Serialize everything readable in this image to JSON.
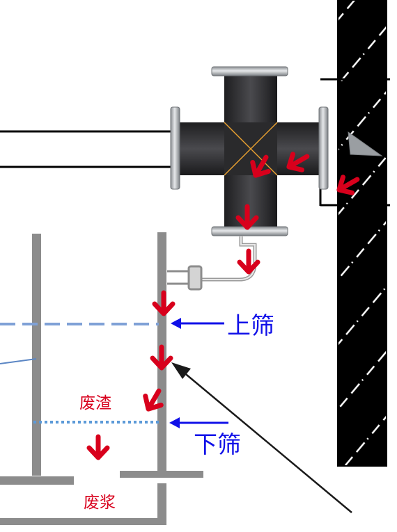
{
  "labels": {
    "upper_screen": "上筛",
    "lower_screen": "下筛",
    "waste_residue": "废渣",
    "waste_slurry": "废浆"
  },
  "colors": {
    "flow_arrow": "#d8001c",
    "screen_label": "#1010e8",
    "residue_label": "#d8001c",
    "tank_wall": "#8c8c8c",
    "cross_fitting": "#2c2c2e",
    "flange": "#c4c8cc",
    "hatch_wall": "#000000",
    "screen_line_upper": "#7fa1d6",
    "screen_line_lower": "#5c9ad8"
  },
  "icons": {
    "flow_arrow": "red-flow-arrow-icon",
    "pointer_arrow": "black-arrow-icon",
    "screen_pointer": "blue-arrow-icon"
  }
}
